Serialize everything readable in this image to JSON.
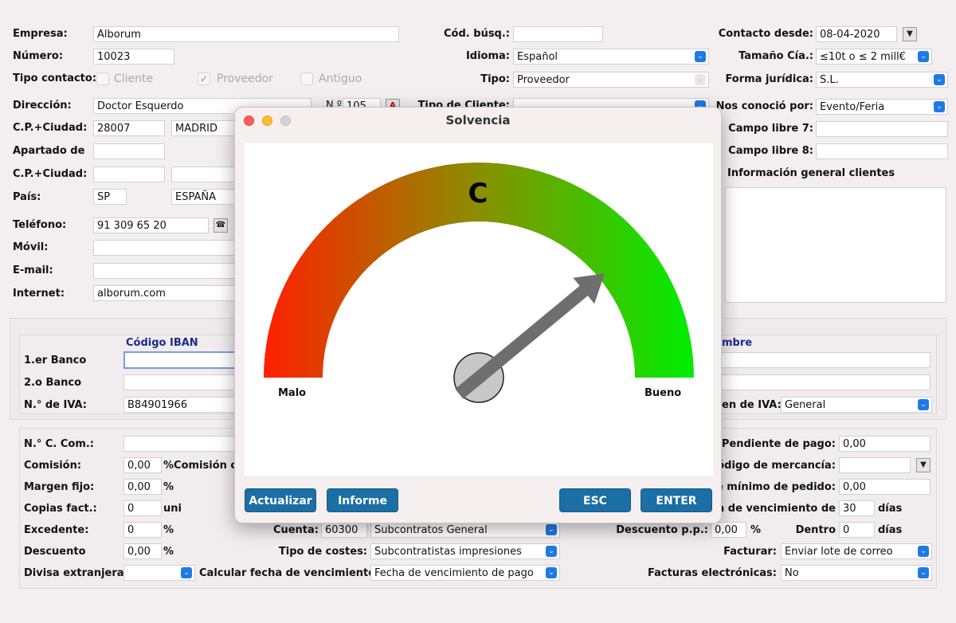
{
  "form": {
    "empresa_label": "Empresa:",
    "empresa_value": "Alborum",
    "numero_label": "Número:",
    "numero_value": "10023",
    "tipo_contacto_label": "Tipo contacto:",
    "cliente_label": "Cliente",
    "proveedor_label": "Proveedor",
    "antiguo_label": "Antiguo",
    "direccion_label": "Dirección:",
    "direccion_value": "Doctor Esquerdo",
    "num_label": "N.º",
    "num_value": "105",
    "cp_ciudad_label": "C.P.+Ciudad:",
    "cp_value": "28007",
    "ciudad_value": "MADRID",
    "apartado_label": "Apartado de",
    "cp_ciudad2_label": "C.P.+Ciudad:",
    "pais_label": "País:",
    "pais_code": "SP",
    "pais_name": "ESPAÑA",
    "telefono_label": "Teléfono:",
    "telefono_value": "91 309 65 20",
    "movil_label": "Móvil:",
    "email_label": "E-mail:",
    "internet_label": "Internet:",
    "internet_value": "alborum.com",
    "cod_busq_label": "Cód. búsq.:",
    "idioma_label": "Idioma:",
    "idioma_value": "Español",
    "tipo_label": "Tipo:",
    "tipo_value": "Proveedor",
    "tipo_cliente_label": "Tipo de Cliente:",
    "contacto_desde_label": "Contacto desde:",
    "contacto_desde_value": "08-04-2020",
    "tamano_label": "Tamaño Cía.:",
    "tamano_value": "≤10t o ≤ 2 mill€",
    "forma_label": "Forma jurídica:",
    "forma_value": "S.L.",
    "nos_conocio_label": "Nos conoció por:",
    "nos_conocio_value": "Evento/Feria",
    "campo7_label": "Campo libre 7:",
    "campo8_label": "Campo libre 8:",
    "info_general_label": "Información general clientes"
  },
  "bank": {
    "iban_header": "Código IBAN",
    "nombre_header": "mbre",
    "banco1_label": "1.er Banco",
    "banco2_label": "2.o Banco",
    "iva_label": "N.° de IVA:",
    "iva_value": "B84901966",
    "regimen_label": "en de IVA:",
    "regimen_value": "General"
  },
  "bottom": {
    "ncom_label": "N.° C. Com.:",
    "comision_label": "Comisión:",
    "comision_value": "0,00",
    "comision_pct": "%Comisión c",
    "margen_label": "Margen fijo:",
    "margen_value": "0,00",
    "margen_pct": "%",
    "copias_label": "Copias fact.:",
    "copias_value": "0",
    "copias_unit": "uni",
    "excedente_label": "Excedente:",
    "excedente_value": "0",
    "excedente_pct": "%",
    "descuento_label": "Descuento",
    "descuento_value": "0,00",
    "descuento_pct": "%",
    "divisa_label": "Divisa extranjera:",
    "cuenta_label": "Cuenta:",
    "cuenta_value": "60300",
    "cuenta_desc": "Subcontratos General",
    "tipo_costes_label": "Tipo de costes:",
    "tipo_costes_value": "Subcontratistas impresiones",
    "calc_label": "Calcular fecha de vencimiento:",
    "calc_value": "Fecha de vencimiento de pago",
    "pendiente_label": "Pendiente de pago:",
    "pendiente_value": "0,00",
    "codigo_merc_label": "Código de mercancía:",
    "minimo_label": "e mínimo de pedido:",
    "minimo_value": "0,00",
    "vencimiento_label": "na de vencimiento de",
    "vencimiento_value": "30",
    "vencimiento_unit": "días",
    "dpp_label": "Descuento p.p.:",
    "dpp_value": "0,00",
    "dpp_pct": "%",
    "dentro_label": "Dentro",
    "dentro_value": "0",
    "dentro_unit": "días",
    "facturar_label": "Facturar:",
    "facturar_value": "Enviar lote  de correo",
    "fact_elec_label": "Facturas electrónicas:",
    "fact_elec_value": "No"
  },
  "dialog": {
    "title": "Solvencia",
    "grade": "C",
    "left_label": "Malo",
    "right_label": "Bueno",
    "gauge_level": 0.78,
    "colors": {
      "bad": "#ff2000",
      "mid": "#8a8f00",
      "good": "#00ee00"
    },
    "buttons": {
      "actualizar": "Actualizar",
      "informe": "Informe",
      "esc": "ESC",
      "enter": "ENTER"
    }
  }
}
